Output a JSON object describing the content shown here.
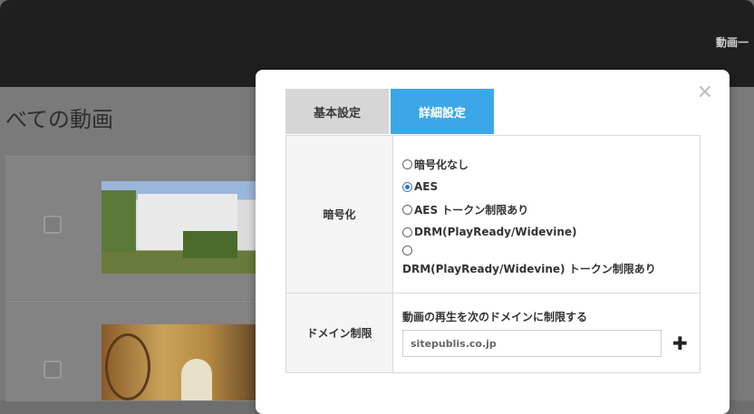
{
  "background": {
    "header_nav": "動画一",
    "page_title": "べての動画"
  },
  "modal": {
    "tabs": [
      {
        "label": "基本設定",
        "active": false
      },
      {
        "label": "詳細設定",
        "active": true
      }
    ],
    "encryption": {
      "label": "暗号化",
      "options": [
        {
          "label": "暗号化なし",
          "checked": false
        },
        {
          "label": "AES",
          "checked": true
        },
        {
          "label": "AES トークン制限あり",
          "checked": false
        },
        {
          "label": "DRM(PlayReady/Widevine)",
          "checked": false
        },
        {
          "label": "DRM(PlayReady/Widevine) トークン制限あり",
          "checked": false
        }
      ]
    },
    "domain": {
      "label": "ドメイン制限",
      "description": "動画の再生を次のドメインに制限する",
      "input_value": "sitepublis.co.jp",
      "add_button": "✚"
    },
    "close_icon": "×"
  },
  "colors": {
    "accent": "#3ca7e8",
    "topbar": "#1f1f1f",
    "overlay": "#7a7a7a"
  }
}
